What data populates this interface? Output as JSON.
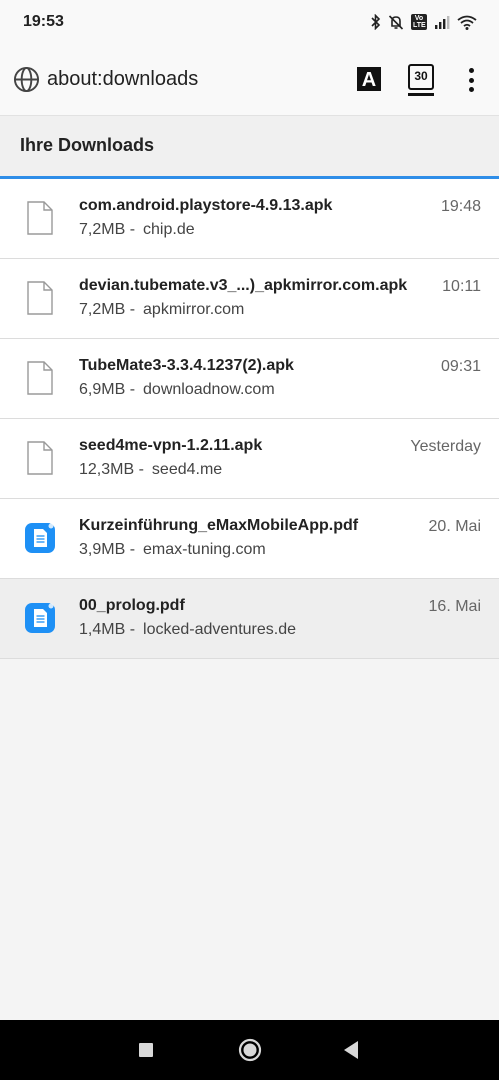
{
  "status_bar": {
    "time": "19:53",
    "icons": [
      "bluetooth-icon",
      "alarm-off-icon",
      "volte-icon",
      "signal-icon",
      "wifi-icon"
    ],
    "volte_label": "Vo LTE"
  },
  "toolbar": {
    "url": "about:downloads",
    "reader_label": "A",
    "tab_count": "30"
  },
  "downloads": {
    "title": "Ihre Downloads",
    "items": [
      {
        "name": "com.android.playstore-4.9.13.apk",
        "size": "7,2MB -",
        "source": "chip.de",
        "time": "19:48",
        "icon": "file-icon"
      },
      {
        "name": "devian.tubemate.v3_...)_apkmirror.com.apk",
        "size": "7,2MB -",
        "source": "apkmirror.com",
        "time": "10:11",
        "icon": "file-icon"
      },
      {
        "name": "TubeMate3-3.3.4.1237(2).apk",
        "size": "6,9MB -",
        "source": "downloadnow.com",
        "time": "09:31",
        "icon": "file-icon"
      },
      {
        "name": "seed4me-vpn-1.2.11.apk",
        "size": "12,3MB -",
        "source": "seed4.me",
        "time": "Yesterday",
        "icon": "file-icon"
      },
      {
        "name": "Kurzeinführung_eMaxMobileApp.pdf",
        "size": "3,9MB -",
        "source": "emax-tuning.com",
        "time": "20. Mai",
        "icon": "document-app-icon"
      },
      {
        "name": "00_prolog.pdf",
        "size": "1,4MB -",
        "source": "locked-adventures.de",
        "time": "16. Mai",
        "icon": "document-app-icon"
      }
    ]
  },
  "colors": {
    "accent_blue": "#2f8ee8",
    "progress_green": "#4cc31f",
    "doc_icon_blue": "#1e90f5"
  }
}
